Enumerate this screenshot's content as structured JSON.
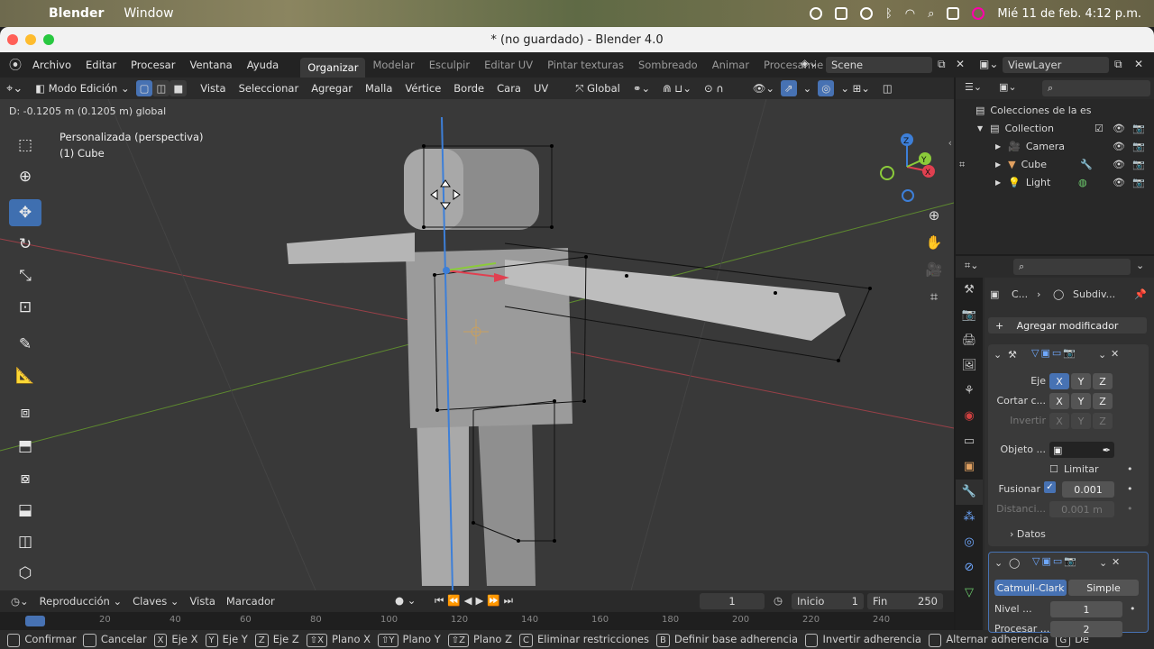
{
  "macos": {
    "app": "Blender",
    "menu": "Window",
    "datetime": "Mié 11 de feb. 4:12 p.m."
  },
  "window": {
    "title": "* (no guardado) - Blender 4.0"
  },
  "topbar": {
    "menus": [
      "Archivo",
      "Editar",
      "Procesar",
      "Ventana",
      "Ayuda"
    ],
    "workspaces": [
      "Organizar",
      "Modelar",
      "Esculpir",
      "Editar UV",
      "Pintar texturas",
      "Sombreado",
      "Animar",
      "Procesamie"
    ],
    "scene": "Scene",
    "view_layer": "ViewLayer"
  },
  "viewport_header": {
    "mode": "Modo Edición",
    "menus": [
      "Vista",
      "Seleccionar",
      "Agregar",
      "Malla",
      "Vértice",
      "Borde",
      "Cara",
      "UV"
    ],
    "orientation": "Global"
  },
  "viewport": {
    "status_line": "D: -0.1205 m (0.1205 m) global",
    "view_name": "Personalizada (perspectiva)",
    "object_name": "(1) Cube",
    "gizmo_axes": [
      "Z",
      "Y",
      "X"
    ]
  },
  "timeline": {
    "menus": [
      "Reproducción",
      "Claves",
      "Vista",
      "Marcador"
    ],
    "current_frame": "1",
    "start_label": "Inicio",
    "start": "1",
    "end_label": "Fin",
    "end": "250",
    "ruler_marks": [
      "0",
      "20",
      "40",
      "60",
      "80",
      "100",
      "120",
      "140",
      "160",
      "180",
      "200",
      "220",
      "240"
    ]
  },
  "statusbar": {
    "items": [
      {
        "key": "",
        "label": "Confirmar"
      },
      {
        "key": "",
        "label": "Cancelar"
      },
      {
        "key": "X",
        "label": "Eje X"
      },
      {
        "key": "Y",
        "label": "Eje Y"
      },
      {
        "key": "Z",
        "label": "Eje Z"
      },
      {
        "key": "⇧X",
        "label": "Plano X"
      },
      {
        "key": "⇧Y",
        "label": "Plano Y"
      },
      {
        "key": "⇧Z",
        "label": "Plano Z"
      },
      {
        "key": "C",
        "label": "Eliminar restricciones"
      },
      {
        "key": "B",
        "label": "Definir base adherencia"
      },
      {
        "key": "",
        "label": "Invertir adherencia"
      },
      {
        "key": "",
        "label": "Alternar adherencia"
      },
      {
        "key": "G",
        "label": "De"
      }
    ]
  },
  "outliner": {
    "root": "Colecciones de la es",
    "collection": "Collection",
    "items": [
      {
        "name": "Camera",
        "icon": "camera-icon"
      },
      {
        "name": "Cube",
        "icon": "mesh-icon"
      },
      {
        "name": "Light",
        "icon": "light-icon"
      }
    ]
  },
  "properties": {
    "breadcrumb_object": "C...",
    "breadcrumb_modifier": "Subdiv...",
    "add_modifier": "Agregar modificador",
    "mirror": {
      "axis_label": "Eje",
      "cut_label": "Cortar c...",
      "invert_label": "Invertir",
      "axes": [
        "X",
        "Y",
        "Z"
      ],
      "object_label": "Objeto ...",
      "limit_label": "Limitar",
      "merge_label": "Fusionar",
      "merge_value": "0.001",
      "distance_label": "Distanci...",
      "distance_value": "0.001 m",
      "data_label": "Datos"
    },
    "subsurf": {
      "type_a": "Catmull-Clark",
      "type_b": "Simple",
      "level_label": "Nivel ...",
      "level_value": "1",
      "render_label": "Procesar ...",
      "render_value": "2"
    }
  },
  "colors": {
    "accent": "#4772b3",
    "x_axis": "#e04050",
    "y_axis": "#8bcb3a",
    "z_axis": "#3d7fd8",
    "viewport_bg": "#393939"
  }
}
